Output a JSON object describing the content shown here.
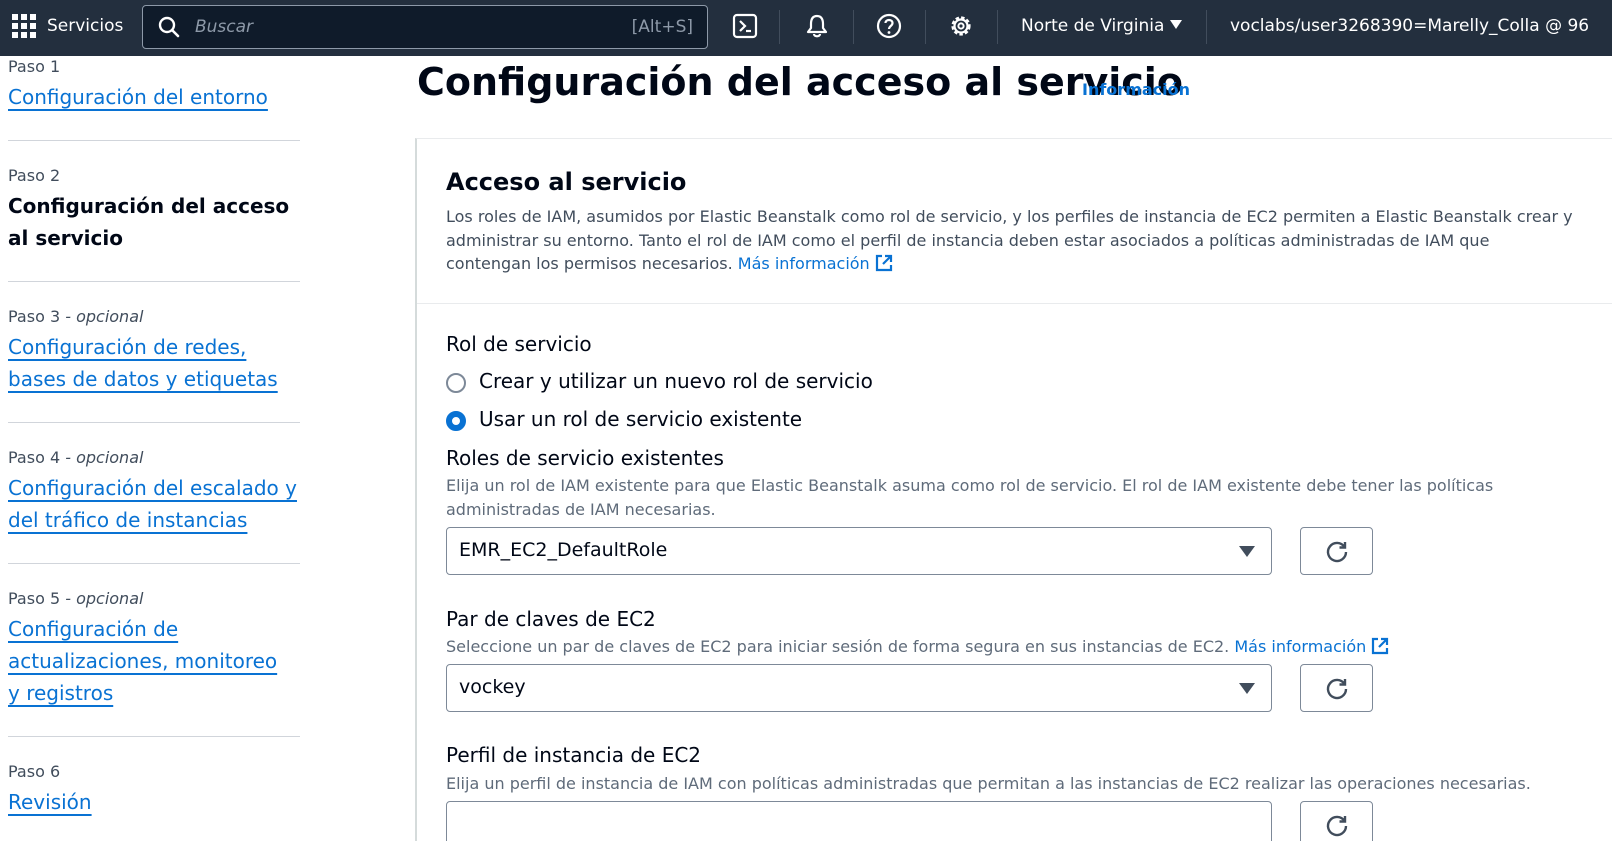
{
  "topnav": {
    "services_label": "Servicios",
    "search_placeholder": "Buscar",
    "search_shortcut": "[Alt+S]",
    "region": "Norte de Virginia",
    "account": "voclabs/user3268390=Marelly_Colla @ 96"
  },
  "steps": [
    {
      "label": "Paso 1",
      "optional": "",
      "title": "Configuración del entorno",
      "current": false
    },
    {
      "label": "Paso 2",
      "optional": "",
      "title": "Configuración del acceso al servicio",
      "current": true
    },
    {
      "label": "Paso 3",
      "optional": " - opcional",
      "title": "Configuración de redes, bases de datos y etiquetas",
      "current": false
    },
    {
      "label": "Paso 4",
      "optional": " - opcional",
      "title": "Configuración del escalado y del tráfico de instancias",
      "current": false
    },
    {
      "label": "Paso 5",
      "optional": " - opcional",
      "title": "Configuración de actualizaciones, monitoreo y registros",
      "current": false
    },
    {
      "label": "Paso 6",
      "optional": "",
      "title": "Revisión",
      "current": false
    }
  ],
  "page": {
    "title": "Configuración del acceso al servicio",
    "info_link": "Información"
  },
  "panel": {
    "title": "Acceso al servicio",
    "description": "Los roles de IAM, asumidos por Elastic Beanstalk como rol de servicio, y los perfiles de instancia de EC2 permiten a Elastic Beanstalk crear y administrar su entorno. Tanto el rol de IAM como el perfil de instancia deben estar asociados a políticas administradas de IAM que contengan los permisos necesarios.",
    "more_info": "Más información"
  },
  "service_role": {
    "label": "Rol de servicio",
    "options": [
      {
        "label": "Crear y utilizar un nuevo rol de servicio",
        "checked": false
      },
      {
        "label": "Usar un rol de servicio existente",
        "checked": true
      }
    ]
  },
  "existing_roles": {
    "label": "Roles de servicio existentes",
    "description": "Elija un rol de IAM existente para que Elastic Beanstalk asuma como rol de servicio. El rol de IAM existente debe tener las políticas administradas de IAM necesarias.",
    "value": "EMR_EC2_DefaultRole"
  },
  "key_pair": {
    "label": "Par de claves de EC2",
    "description": "Seleccione un par de claves de EC2 para iniciar sesión de forma segura en sus instancias de EC2.",
    "more_info": "Más información",
    "value": "vockey"
  },
  "instance_profile": {
    "label": "Perfil de instancia de EC2",
    "description": "Elija un perfil de instancia de IAM con políticas administradas que permitan a las instancias de EC2 realizar las operaciones necesarias.",
    "value": ""
  },
  "colors": {
    "nav_bg": "#232f3e",
    "link": "#0972d3",
    "text": "#000716",
    "muted": "#5f6b7a"
  }
}
